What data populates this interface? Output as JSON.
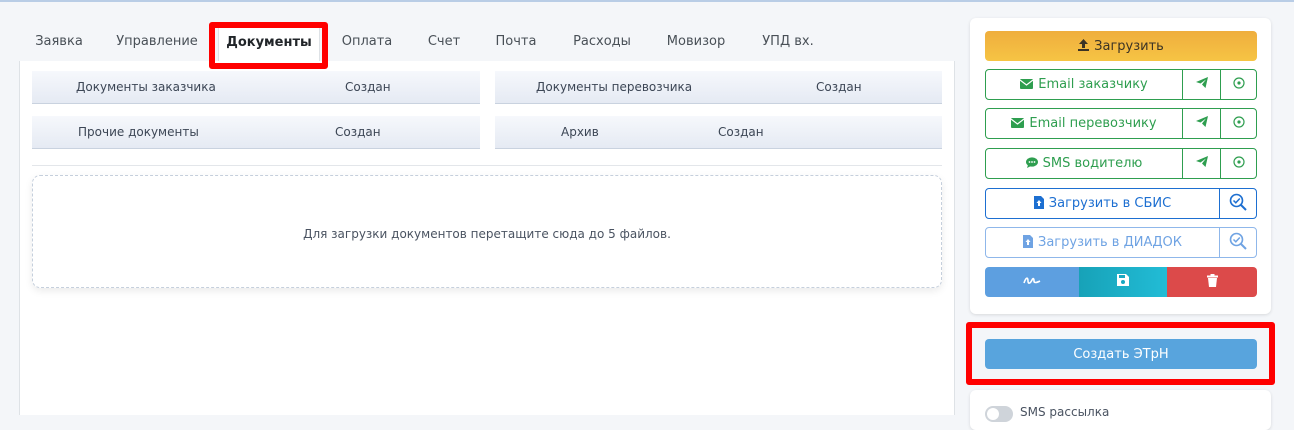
{
  "tabs": [
    "Заявка",
    "Управление",
    "Документы",
    "Оплата",
    "Счет",
    "Почта",
    "Расходы",
    "Мовизор",
    "УПД вх."
  ],
  "doc_sections": [
    {
      "label": "Документы заказчика",
      "created": "Создан"
    },
    {
      "label": "Документы перевозчика",
      "created": "Создан"
    },
    {
      "label": "Прочие документы",
      "created": "Создан"
    },
    {
      "label": "Архив",
      "created": "Создан"
    }
  ],
  "dropzone_text": "Для загрузки документов перетащите сюда до 5 файлов.",
  "actions": {
    "upload": "Загрузить",
    "email_customer": "Email заказчику",
    "email_carrier": "Email перевозчику",
    "sms_driver": "SMS водителю",
    "upload_sbis": "Загрузить в СБИС",
    "upload_diadok": "Загрузить в ДИАДОК",
    "create_etrn": "Создать ЭТрН",
    "sms_toggle": "SMS рассылка"
  },
  "colors": {
    "upload": "#f3b940",
    "green": "#2e9e4f",
    "blue": "#1d6fd1",
    "sign": "#5d9fe0",
    "save": "#17a2b8",
    "delete": "#dc3545",
    "etrn": "#58a4dd",
    "highlight": "#ff0000"
  }
}
